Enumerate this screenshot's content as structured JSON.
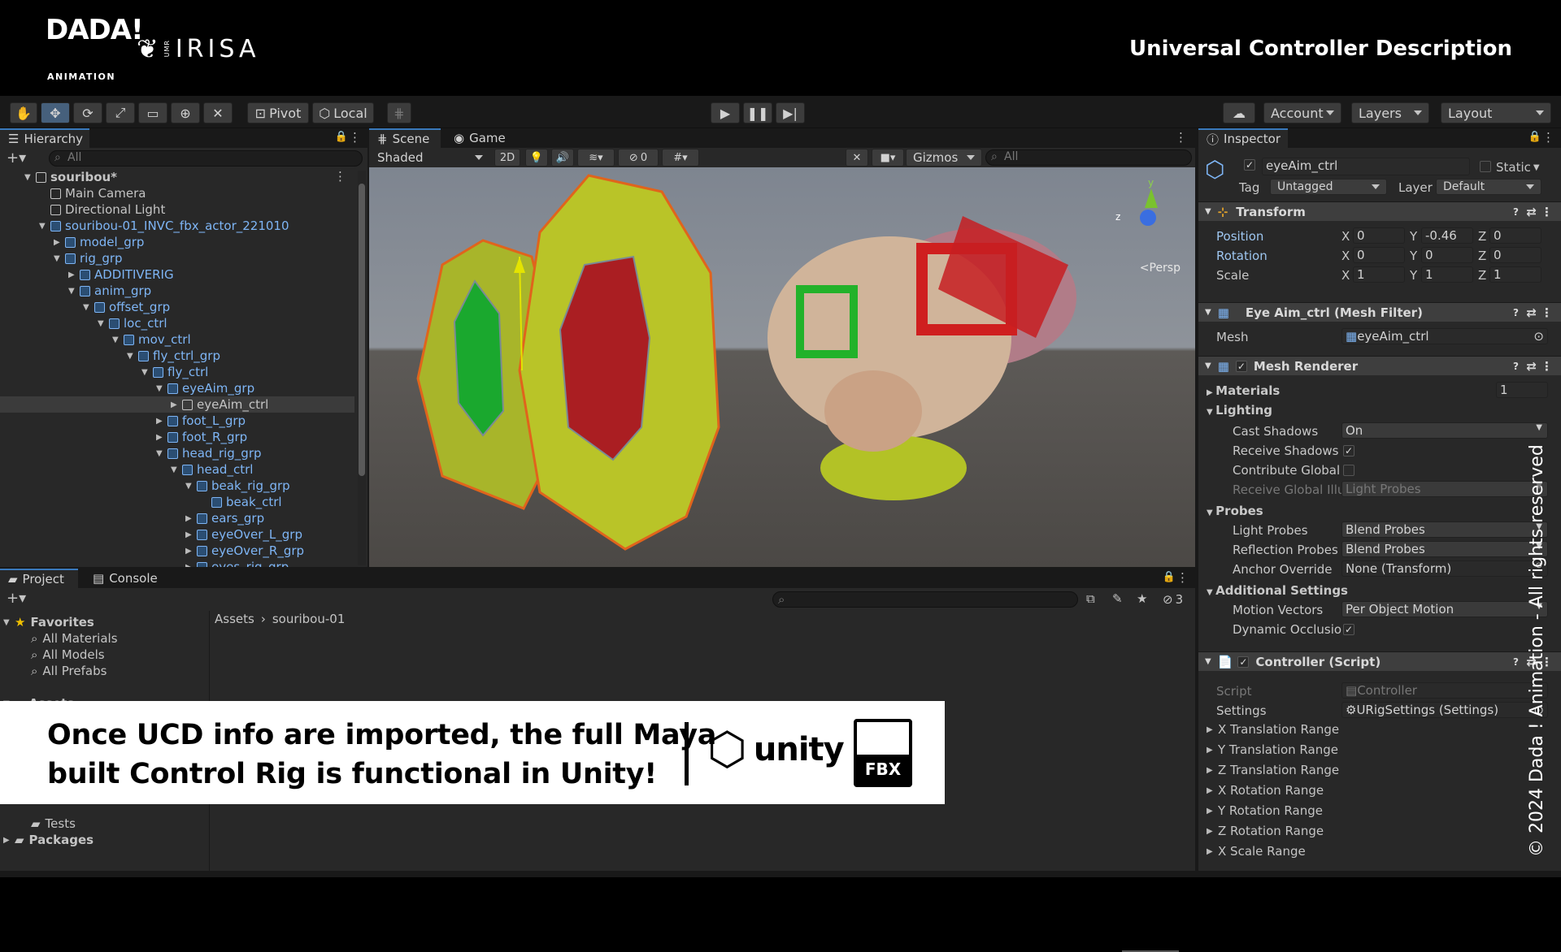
{
  "banner": {
    "dada_text": "DADA!",
    "dada_sub": "ANIMATION",
    "irisa_umr": "UMR",
    "irisa_text": "IRISA",
    "title": "Universal Controller Description"
  },
  "toolbar": {
    "pivot": "Pivot",
    "local": "Local",
    "account": "Account",
    "layers": "Layers",
    "layout": "Layout"
  },
  "hierarchy": {
    "tab": "Hierarchy",
    "search_placeholder": "All",
    "rows": [
      {
        "label": "souribou*",
        "depth": 0,
        "icon": "unity-scene-icon",
        "arrow": "▼",
        "bold": true
      },
      {
        "label": "Main Camera",
        "depth": 1,
        "icon": "gameobject-icon",
        "arrow": ""
      },
      {
        "label": "Directional Light",
        "depth": 1,
        "icon": "gameobject-icon",
        "arrow": ""
      },
      {
        "label": "souribou-01_INVC_fbx_actor_221010",
        "depth": 1,
        "icon": "prefab-icon",
        "arrow": "▼",
        "blue": true
      },
      {
        "label": "model_grp",
        "depth": 2,
        "icon": "gameobject-icon",
        "arrow": "▶",
        "blue": true
      },
      {
        "label": "rig_grp",
        "depth": 2,
        "icon": "gameobject-icon",
        "arrow": "▼",
        "blue": true
      },
      {
        "label": "ADDITIVERIG",
        "depth": 3,
        "icon": "gameobject-icon",
        "arrow": "▶",
        "blue": true
      },
      {
        "label": "anim_grp",
        "depth": 3,
        "icon": "gameobject-icon",
        "arrow": "▼",
        "blue": true
      },
      {
        "label": "offset_grp",
        "depth": 4,
        "icon": "gameobject-icon",
        "arrow": "▼",
        "blue": true
      },
      {
        "label": "loc_ctrl",
        "depth": 5,
        "icon": "gameobject-icon",
        "arrow": "▼",
        "blue": true
      },
      {
        "label": "mov_ctrl",
        "depth": 6,
        "icon": "gameobject-icon",
        "arrow": "▼",
        "blue": true
      },
      {
        "label": "fly_ctrl_grp",
        "depth": 7,
        "icon": "gameobject-icon",
        "arrow": "▼",
        "blue": true
      },
      {
        "label": "fly_ctrl",
        "depth": 8,
        "icon": "gameobject-icon",
        "arrow": "▼",
        "blue": true
      },
      {
        "label": "eyeAim_grp",
        "depth": 9,
        "icon": "gameobject-icon",
        "arrow": "▼",
        "blue": true
      },
      {
        "label": "eyeAim_ctrl",
        "depth": 10,
        "icon": "gameobject-icon",
        "arrow": "▶",
        "selected": true
      },
      {
        "label": "foot_L_grp",
        "depth": 9,
        "icon": "gameobject-icon",
        "arrow": "▶",
        "blue": true
      },
      {
        "label": "foot_R_grp",
        "depth": 9,
        "icon": "gameobject-icon",
        "arrow": "▶",
        "blue": true
      },
      {
        "label": "head_rig_grp",
        "depth": 9,
        "icon": "gameobject-icon",
        "arrow": "▼",
        "blue": true
      },
      {
        "label": "head_ctrl",
        "depth": 10,
        "icon": "gameobject-icon",
        "arrow": "▼",
        "blue": true
      },
      {
        "label": "beak_rig_grp",
        "depth": 11,
        "icon": "gameobject-icon",
        "arrow": "▼",
        "blue": true
      },
      {
        "label": "beak_ctrl",
        "depth": 12,
        "icon": "gameobject-icon",
        "arrow": "",
        "blue": true
      },
      {
        "label": "ears_grp",
        "depth": 11,
        "icon": "gameobject-icon",
        "arrow": "▶",
        "blue": true
      },
      {
        "label": "eyeOver_L_grp",
        "depth": 11,
        "icon": "gameobject-icon",
        "arrow": "▶",
        "blue": true
      },
      {
        "label": "eyeOver_R_grp",
        "depth": 11,
        "icon": "gameobject-icon",
        "arrow": "▶",
        "blue": true
      },
      {
        "label": "eyes_rig_grp",
        "depth": 11,
        "icon": "gameobject-icon",
        "arrow": "▶",
        "blue": true
      }
    ]
  },
  "scene": {
    "tab_scene": "Scene",
    "tab_game": "Game",
    "shading": "Shaded",
    "mode_2d": "2D",
    "hidden_count": "0",
    "gizmos": "Gizmos",
    "search_placeholder": "All",
    "persp": "<Persp",
    "axis_y": "y",
    "axis_z": "z"
  },
  "inspector": {
    "tab": "Inspector",
    "object_name": "eyeAim_ctrl",
    "static_label": "Static",
    "tag_label": "Tag",
    "tag_value": "Untagged",
    "layer_label": "Layer",
    "layer_value": "Default",
    "transform": {
      "title": "Transform",
      "position_label": "Position",
      "pos": [
        "0",
        "-0.46",
        "0"
      ],
      "rotation_label": "Rotation",
      "rot": [
        "0",
        "0",
        "0"
      ],
      "scale_label": "Scale",
      "scale": [
        "1",
        "1",
        "1"
      ],
      "x": "X",
      "y": "Y",
      "z": "Z"
    },
    "mesh_filter": {
      "title": "Eye Aim_ctrl (Mesh Filter)",
      "mesh_label": "Mesh",
      "mesh_value": "eyeAim_ctrl"
    },
    "mesh_renderer": {
      "title": "Mesh Renderer",
      "materials": "Materials",
      "materials_count": "1",
      "lighting": "Lighting",
      "cast_shadows": "Cast Shadows",
      "cast_shadows_value": "On",
      "receive_shadows": "Receive Shadows",
      "contribute_gi": "Contribute Global I",
      "receive_gi": "Receive Global Illu",
      "receive_gi_value": "Light Probes",
      "probes": "Probes",
      "light_probes": "Light Probes",
      "light_probes_value": "Blend Probes",
      "reflection_probes": "Reflection Probes",
      "reflection_probes_value": "Blend Probes",
      "anchor_override": "Anchor Override",
      "anchor_override_value": "None (Transform)",
      "additional": "Additional Settings",
      "motion_vectors": "Motion Vectors",
      "motion_vectors_value": "Per Object Motion",
      "dynamic_occlusion": "Dynamic Occlusio"
    },
    "controller": {
      "title": "Controller (Script)",
      "script_label": "Script",
      "script_value": "Controller",
      "settings_label": "Settings",
      "settings_value": "URigSettings (Settings)",
      "ranges": [
        "X Translation Range",
        "Y Translation Range",
        "Z Translation Range",
        "X Rotation Range",
        "Y Rotation Range",
        "Z Rotation Range",
        "X Scale Range"
      ]
    }
  },
  "project": {
    "tab_project": "Project",
    "tab_console": "Console",
    "favorites": "Favorites",
    "fav_items": [
      "All Materials",
      "All Models",
      "All Prefabs"
    ],
    "assets": "Assets",
    "tests": "Tests",
    "packages": "Packages",
    "breadcrumb_root": "Assets",
    "breadcrumb_child": "souribou-01",
    "hidden_count": "3"
  },
  "overlay": {
    "line1": "Once UCD info are imported, the full Maya",
    "line2": "built Control Rig is functional in Unity!",
    "unity_label": "unity",
    "fbx_label": "FBX"
  },
  "copyright": "© 2024 Dada ! Animation - All rights reserved",
  "colors": {
    "accent": "#3a79bb",
    "prefab_blue": "#7eb5f5",
    "selection": "#2c5d87"
  }
}
